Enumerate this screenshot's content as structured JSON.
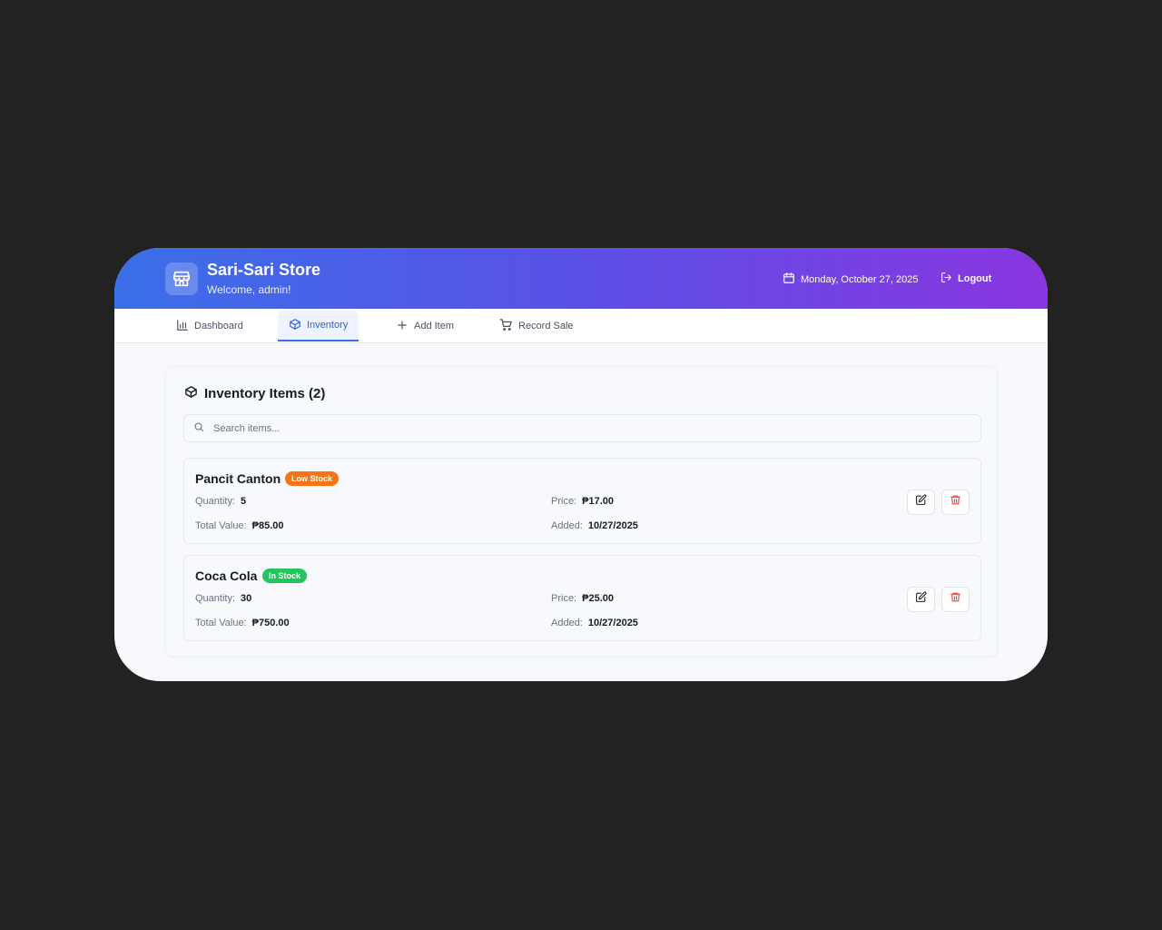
{
  "header": {
    "title": "Sari-Sari Store",
    "subtitle": "Welcome, admin!",
    "date": "Monday, October 27, 2025",
    "logout_label": "Logout",
    "logo_icon": "store-icon"
  },
  "nav": {
    "tabs": [
      {
        "label": "Dashboard",
        "icon": "bar-chart-icon",
        "active": false
      },
      {
        "label": "Inventory",
        "icon": "package-icon",
        "active": true
      },
      {
        "label": "Add Item",
        "icon": "plus-icon",
        "active": false
      },
      {
        "label": "Record Sale",
        "icon": "cart-icon",
        "active": false
      }
    ]
  },
  "inventory": {
    "title": "Inventory Items (2)",
    "search_placeholder": "Search items...",
    "search_value": "",
    "items": [
      {
        "name": "Pancit Canton",
        "badge": "Low Stock",
        "badge_color": "#f97316",
        "quantity_label": "Quantity:",
        "quantity": "5",
        "price_label": "Price:",
        "price": "₱17.00",
        "total_label": "Total Value:",
        "total": "₱85.00",
        "added_label": "Added:",
        "added": "10/27/2025"
      },
      {
        "name": "Coca Cola",
        "badge": "In Stock",
        "badge_color": "#22c55e",
        "quantity_label": "Quantity:",
        "quantity": "30",
        "price_label": "Price:",
        "price": "₱25.00",
        "total_label": "Total Value:",
        "total": "₱750.00",
        "added_label": "Added:",
        "added": "10/27/2025"
      }
    ]
  },
  "colors": {
    "header_gradient": [
      "#3a6fe8",
      "#8a36e0"
    ],
    "accent": "#3b6fe6",
    "delete": "#e53935"
  }
}
